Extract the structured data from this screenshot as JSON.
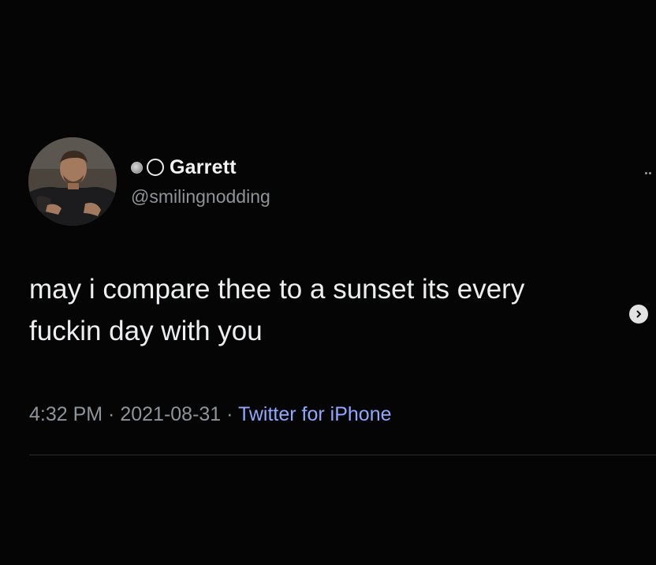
{
  "user": {
    "display_name": "Garrett",
    "handle": "@smilingnodding",
    "name_emojis": [
      "globe-emoji-icon",
      "hollow-circle-icon"
    ]
  },
  "tweet": {
    "text": "may i compare thee to a sunset its every fuckin day with you",
    "time": "4:32 PM",
    "date": "2021-08-31",
    "source": "Twitter for iPhone",
    "separator": " · "
  },
  "colors": {
    "background": "#050505",
    "text": "#eceeef",
    "muted": "#8f9499",
    "source_link": "#8fa8ff"
  },
  "icons": {
    "more": "more-dots-icon",
    "next": "chevron-right-icon"
  }
}
